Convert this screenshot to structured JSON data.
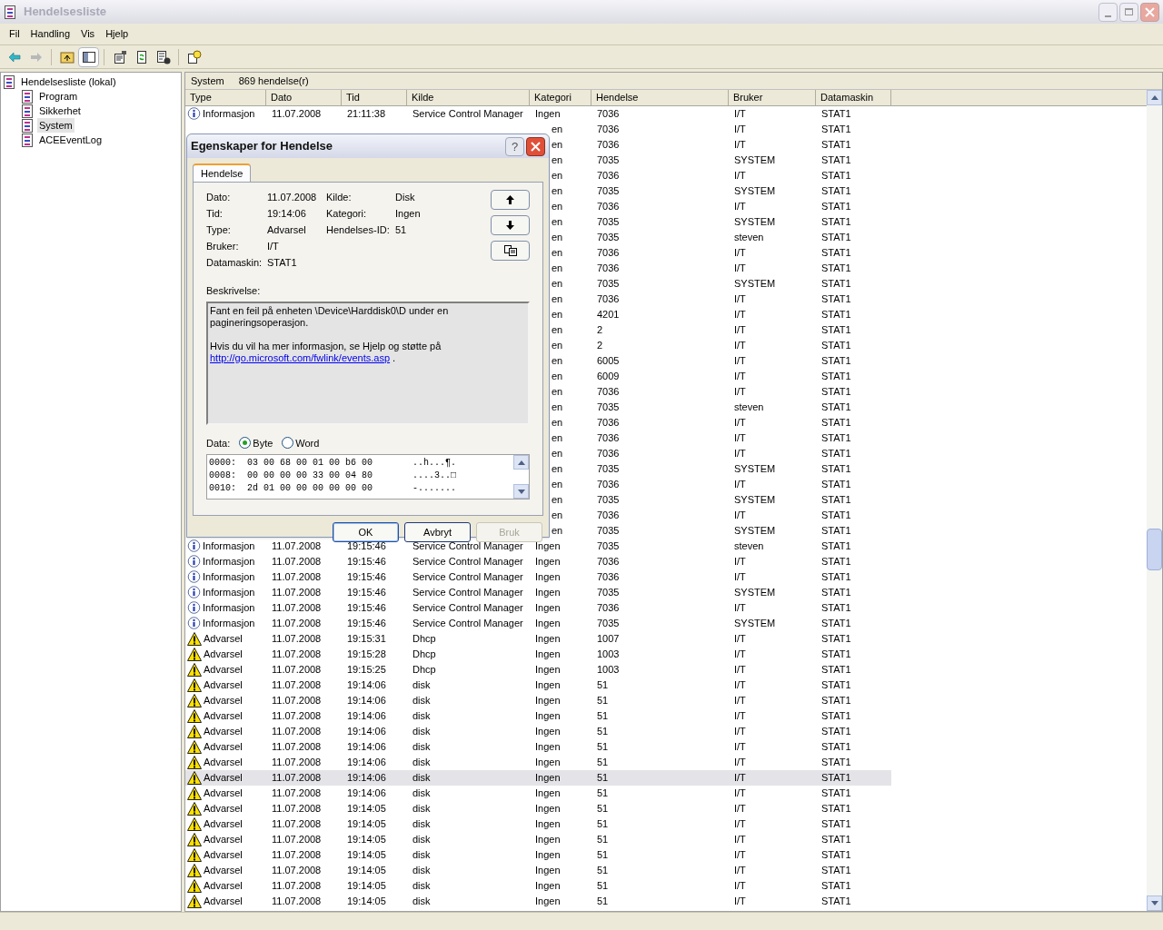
{
  "window": {
    "title": "Hendelsesliste"
  },
  "menu": [
    "Fil",
    "Handling",
    "Vis",
    "Hjelp"
  ],
  "tree": {
    "label": "Hendelsesliste (lokal)",
    "children": [
      {
        "label": "Program",
        "selected": false
      },
      {
        "label": "Sikkerhet",
        "selected": false
      },
      {
        "label": "System",
        "selected": true
      },
      {
        "label": "ACEEventLog",
        "selected": false
      }
    ]
  },
  "pane_header": {
    "name": "System",
    "count": "869 hendelse(r)"
  },
  "table": {
    "columns": [
      "Type",
      "Dato",
      "Tid",
      "Kilde",
      "Kategori",
      "Hendelse",
      "Bruker",
      "Datamaskin"
    ],
    "rows": [
      {
        "kind": "info",
        "type": "Informasjon",
        "dato": "11.07.2008",
        "tid": "21:11:38",
        "kilde": "Service Control Manager",
        "kategori": "Ingen",
        "hendelse": "7036",
        "bruker": "I/T",
        "datamaskin": "STAT1",
        "selected": false
      },
      {
        "kategori": "en",
        "hendelse": "7036",
        "bruker": "I/T",
        "datamaskin": "STAT1",
        "selected": false
      },
      {
        "kategori": "en",
        "hendelse": "7036",
        "bruker": "I/T",
        "datamaskin": "STAT1",
        "selected": false
      },
      {
        "kategori": "en",
        "hendelse": "7035",
        "bruker": "SYSTEM",
        "datamaskin": "STAT1",
        "selected": false
      },
      {
        "kategori": "en",
        "hendelse": "7036",
        "bruker": "I/T",
        "datamaskin": "STAT1",
        "selected": false
      },
      {
        "kategori": "en",
        "hendelse": "7035",
        "bruker": "SYSTEM",
        "datamaskin": "STAT1",
        "selected": false
      },
      {
        "kategori": "en",
        "hendelse": "7036",
        "bruker": "I/T",
        "datamaskin": "STAT1",
        "selected": false
      },
      {
        "kategori": "en",
        "hendelse": "7035",
        "bruker": "SYSTEM",
        "datamaskin": "STAT1",
        "selected": false
      },
      {
        "kategori": "en",
        "hendelse": "7035",
        "bruker": "steven",
        "datamaskin": "STAT1",
        "selected": false
      },
      {
        "kategori": "en",
        "hendelse": "7036",
        "bruker": "I/T",
        "datamaskin": "STAT1",
        "selected": false
      },
      {
        "kategori": "en",
        "hendelse": "7036",
        "bruker": "I/T",
        "datamaskin": "STAT1",
        "selected": false
      },
      {
        "kategori": "en",
        "hendelse": "7035",
        "bruker": "SYSTEM",
        "datamaskin": "STAT1",
        "selected": false
      },
      {
        "kategori": "en",
        "hendelse": "7036",
        "bruker": "I/T",
        "datamaskin": "STAT1",
        "selected": false
      },
      {
        "kategori": "en",
        "hendelse": "4201",
        "bruker": "I/T",
        "datamaskin": "STAT1",
        "selected": false
      },
      {
        "kategori": "en",
        "hendelse": "2",
        "bruker": "I/T",
        "datamaskin": "STAT1",
        "selected": false
      },
      {
        "kategori": "en",
        "hendelse": "2",
        "bruker": "I/T",
        "datamaskin": "STAT1",
        "selected": false
      },
      {
        "kategori": "en",
        "hendelse": "6005",
        "bruker": "I/T",
        "datamaskin": "STAT1",
        "selected": false
      },
      {
        "kategori": "en",
        "hendelse": "6009",
        "bruker": "I/T",
        "datamaskin": "STAT1",
        "selected": false
      },
      {
        "kategori": "en",
        "hendelse": "7036",
        "bruker": "I/T",
        "datamaskin": "STAT1",
        "selected": false
      },
      {
        "kategori": "en",
        "hendelse": "7035",
        "bruker": "steven",
        "datamaskin": "STAT1",
        "selected": false
      },
      {
        "kategori": "en",
        "hendelse": "7036",
        "bruker": "I/T",
        "datamaskin": "STAT1",
        "selected": false
      },
      {
        "kategori": "en",
        "hendelse": "7036",
        "bruker": "I/T",
        "datamaskin": "STAT1",
        "selected": false
      },
      {
        "kategori": "en",
        "hendelse": "7036",
        "bruker": "I/T",
        "datamaskin": "STAT1",
        "selected": false
      },
      {
        "kategori": "en",
        "hendelse": "7035",
        "bruker": "SYSTEM",
        "datamaskin": "STAT1",
        "selected": false
      },
      {
        "kategori": "en",
        "hendelse": "7036",
        "bruker": "I/T",
        "datamaskin": "STAT1",
        "selected": false
      },
      {
        "kategori": "en",
        "hendelse": "7035",
        "bruker": "SYSTEM",
        "datamaskin": "STAT1",
        "selected": false
      },
      {
        "kategori": "en",
        "hendelse": "7036",
        "bruker": "I/T",
        "datamaskin": "STAT1",
        "selected": false
      },
      {
        "kategori": "en",
        "hendelse": "7035",
        "bruker": "SYSTEM",
        "datamaskin": "STAT1",
        "selected": false
      },
      {
        "kind": "info",
        "type": "Informasjon",
        "dato": "11.07.2008",
        "tid": "19:15:46",
        "kilde": "Service Control Manager",
        "kategori": "Ingen",
        "hendelse": "7035",
        "bruker": "steven",
        "datamaskin": "STAT1",
        "selected": false
      },
      {
        "kind": "info",
        "type": "Informasjon",
        "dato": "11.07.2008",
        "tid": "19:15:46",
        "kilde": "Service Control Manager",
        "kategori": "Ingen",
        "hendelse": "7036",
        "bruker": "I/T",
        "datamaskin": "STAT1",
        "selected": false
      },
      {
        "kind": "info",
        "type": "Informasjon",
        "dato": "11.07.2008",
        "tid": "19:15:46",
        "kilde": "Service Control Manager",
        "kategori": "Ingen",
        "hendelse": "7036",
        "bruker": "I/T",
        "datamaskin": "STAT1",
        "selected": false
      },
      {
        "kind": "info",
        "type": "Informasjon",
        "dato": "11.07.2008",
        "tid": "19:15:46",
        "kilde": "Service Control Manager",
        "kategori": "Ingen",
        "hendelse": "7035",
        "bruker": "SYSTEM",
        "datamaskin": "STAT1",
        "selected": false
      },
      {
        "kind": "info",
        "type": "Informasjon",
        "dato": "11.07.2008",
        "tid": "19:15:46",
        "kilde": "Service Control Manager",
        "kategori": "Ingen",
        "hendelse": "7036",
        "bruker": "I/T",
        "datamaskin": "STAT1",
        "selected": false
      },
      {
        "kind": "info",
        "type": "Informasjon",
        "dato": "11.07.2008",
        "tid": "19:15:46",
        "kilde": "Service Control Manager",
        "kategori": "Ingen",
        "hendelse": "7035",
        "bruker": "SYSTEM",
        "datamaskin": "STAT1",
        "selected": false
      },
      {
        "kind": "warning",
        "type": "Advarsel",
        "dato": "11.07.2008",
        "tid": "19:15:31",
        "kilde": "Dhcp",
        "kategori": "Ingen",
        "hendelse": "1007",
        "bruker": "I/T",
        "datamaskin": "STAT1",
        "selected": false
      },
      {
        "kind": "warning",
        "type": "Advarsel",
        "dato": "11.07.2008",
        "tid": "19:15:28",
        "kilde": "Dhcp",
        "kategori": "Ingen",
        "hendelse": "1003",
        "bruker": "I/T",
        "datamaskin": "STAT1",
        "selected": false
      },
      {
        "kind": "warning",
        "type": "Advarsel",
        "dato": "11.07.2008",
        "tid": "19:15:25",
        "kilde": "Dhcp",
        "kategori": "Ingen",
        "hendelse": "1003",
        "bruker": "I/T",
        "datamaskin": "STAT1",
        "selected": false
      },
      {
        "kind": "warning",
        "type": "Advarsel",
        "dato": "11.07.2008",
        "tid": "19:14:06",
        "kilde": "disk",
        "kategori": "Ingen",
        "hendelse": "51",
        "bruker": "I/T",
        "datamaskin": "STAT1",
        "selected": false
      },
      {
        "kind": "warning",
        "type": "Advarsel",
        "dato": "11.07.2008",
        "tid": "19:14:06",
        "kilde": "disk",
        "kategori": "Ingen",
        "hendelse": "51",
        "bruker": "I/T",
        "datamaskin": "STAT1",
        "selected": false
      },
      {
        "kind": "warning",
        "type": "Advarsel",
        "dato": "11.07.2008",
        "tid": "19:14:06",
        "kilde": "disk",
        "kategori": "Ingen",
        "hendelse": "51",
        "bruker": "I/T",
        "datamaskin": "STAT1",
        "selected": false
      },
      {
        "kind": "warning",
        "type": "Advarsel",
        "dato": "11.07.2008",
        "tid": "19:14:06",
        "kilde": "disk",
        "kategori": "Ingen",
        "hendelse": "51",
        "bruker": "I/T",
        "datamaskin": "STAT1",
        "selected": false
      },
      {
        "kind": "warning",
        "type": "Advarsel",
        "dato": "11.07.2008",
        "tid": "19:14:06",
        "kilde": "disk",
        "kategori": "Ingen",
        "hendelse": "51",
        "bruker": "I/T",
        "datamaskin": "STAT1",
        "selected": false
      },
      {
        "kind": "warning",
        "type": "Advarsel",
        "dato": "11.07.2008",
        "tid": "19:14:06",
        "kilde": "disk",
        "kategori": "Ingen",
        "hendelse": "51",
        "bruker": "I/T",
        "datamaskin": "STAT1",
        "selected": false
      },
      {
        "kind": "warning",
        "type": "Advarsel",
        "dato": "11.07.2008",
        "tid": "19:14:06",
        "kilde": "disk",
        "kategori": "Ingen",
        "hendelse": "51",
        "bruker": "I/T",
        "datamaskin": "STAT1",
        "selected": true
      },
      {
        "kind": "warning",
        "type": "Advarsel",
        "dato": "11.07.2008",
        "tid": "19:14:06",
        "kilde": "disk",
        "kategori": "Ingen",
        "hendelse": "51",
        "bruker": "I/T",
        "datamaskin": "STAT1",
        "selected": false
      },
      {
        "kind": "warning",
        "type": "Advarsel",
        "dato": "11.07.2008",
        "tid": "19:14:05",
        "kilde": "disk",
        "kategori": "Ingen",
        "hendelse": "51",
        "bruker": "I/T",
        "datamaskin": "STAT1",
        "selected": false
      },
      {
        "kind": "warning",
        "type": "Advarsel",
        "dato": "11.07.2008",
        "tid": "19:14:05",
        "kilde": "disk",
        "kategori": "Ingen",
        "hendelse": "51",
        "bruker": "I/T",
        "datamaskin": "STAT1",
        "selected": false
      },
      {
        "kind": "warning",
        "type": "Advarsel",
        "dato": "11.07.2008",
        "tid": "19:14:05",
        "kilde": "disk",
        "kategori": "Ingen",
        "hendelse": "51",
        "bruker": "I/T",
        "datamaskin": "STAT1",
        "selected": false
      },
      {
        "kind": "warning",
        "type": "Advarsel",
        "dato": "11.07.2008",
        "tid": "19:14:05",
        "kilde": "disk",
        "kategori": "Ingen",
        "hendelse": "51",
        "bruker": "I/T",
        "datamaskin": "STAT1",
        "selected": false
      },
      {
        "kind": "warning",
        "type": "Advarsel",
        "dato": "11.07.2008",
        "tid": "19:14:05",
        "kilde": "disk",
        "kategori": "Ingen",
        "hendelse": "51",
        "bruker": "I/T",
        "datamaskin": "STAT1",
        "selected": false
      },
      {
        "kind": "warning",
        "type": "Advarsel",
        "dato": "11.07.2008",
        "tid": "19:14:05",
        "kilde": "disk",
        "kategori": "Ingen",
        "hendelse": "51",
        "bruker": "I/T",
        "datamaskin": "STAT1",
        "selected": false
      },
      {
        "kind": "warning",
        "type": "Advarsel",
        "dato": "11.07.2008",
        "tid": "19:14:05",
        "kilde": "disk",
        "kategori": "Ingen",
        "hendelse": "51",
        "bruker": "I/T",
        "datamaskin": "STAT1",
        "selected": false
      }
    ]
  },
  "dialog": {
    "title": "Egenskaper for Hendelse",
    "help": "?",
    "tab": "Hendelse",
    "fields_left": [
      {
        "label": "Dato:",
        "value": "11.07.2008"
      },
      {
        "label": "Tid:",
        "value": "19:14:06"
      },
      {
        "label": "Type:",
        "value": "Advarsel"
      },
      {
        "label": "Bruker:",
        "value": "I/T"
      },
      {
        "label": "Datamaskin:",
        "value": "STAT1"
      }
    ],
    "fields_right": [
      {
        "label": "Kilde:",
        "value": "Disk"
      },
      {
        "label": "Kategori:",
        "value": "Ingen"
      },
      {
        "label": "Hendelses-ID:",
        "value": "51"
      }
    ],
    "description_label": "Beskrivelse:",
    "description": [
      "Fant en feil på enheten \\Device\\Harddisk0\\D under en pagineringsoperasjon.",
      "Hvis du vil ha mer informasjon, se Hjelp og støtte på"
    ],
    "link": "http://go.microsoft.com/fwlink/events.asp",
    "link_after": ".",
    "data_label": "Data:",
    "radios": [
      {
        "label": "Byte",
        "selected": true
      },
      {
        "label": "Word",
        "selected": false
      }
    ],
    "hex": [
      {
        "offset": "0000:",
        "bytes": "03 00 68 00 01 00 b6 00",
        "ascii": "..h...¶."
      },
      {
        "offset": "0008:",
        "bytes": "00 00 00 00 33 00 04 80",
        "ascii": "....3..□"
      },
      {
        "offset": "0010:",
        "bytes": "2d 01 00 00 00 00 00 00",
        "ascii": "-......."
      }
    ],
    "buttons": [
      {
        "label": "OK",
        "disabled": false
      },
      {
        "label": "Avbryt",
        "disabled": false
      },
      {
        "label": "Bruk",
        "disabled": true
      }
    ]
  }
}
